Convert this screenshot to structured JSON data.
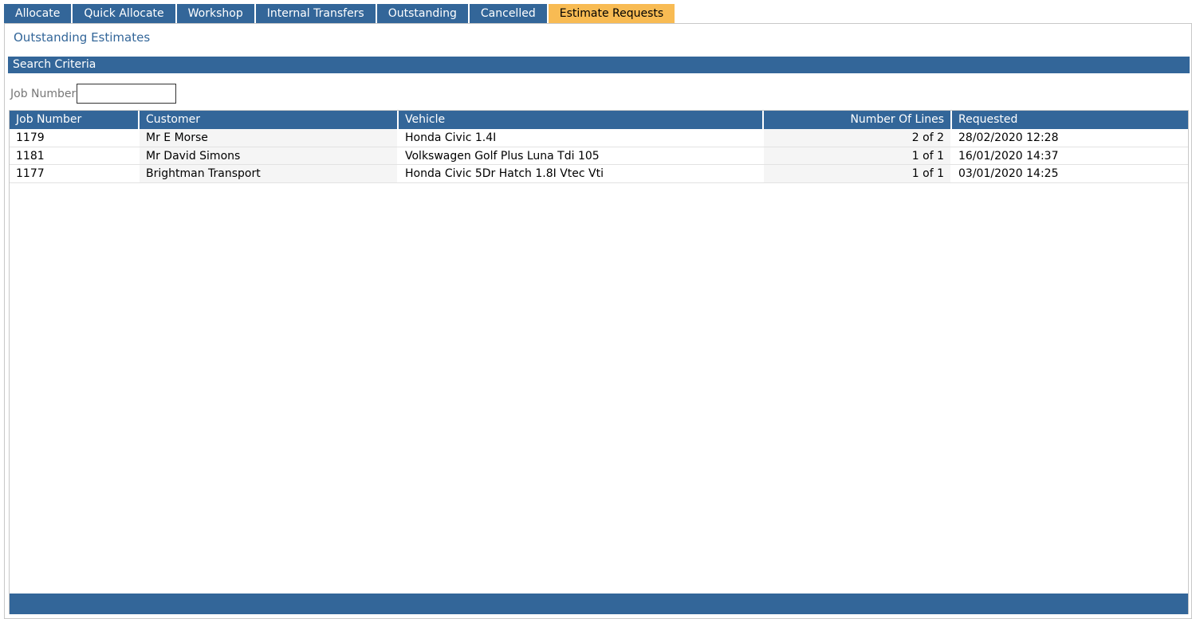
{
  "tabs": [
    {
      "label": "Allocate",
      "active": false
    },
    {
      "label": "Quick Allocate",
      "active": false
    },
    {
      "label": "Workshop",
      "active": false
    },
    {
      "label": "Internal Transfers",
      "active": false
    },
    {
      "label": "Outstanding",
      "active": false
    },
    {
      "label": "Cancelled",
      "active": false
    },
    {
      "label": "Estimate Requests",
      "active": true
    }
  ],
  "page_title": "Outstanding Estimates",
  "search": {
    "header": "Search Criteria",
    "job_number_label": "Job Number",
    "job_number_value": ""
  },
  "table": {
    "columns": [
      "Job Number",
      "Customer",
      "Vehicle",
      "Number Of Lines",
      "Requested"
    ],
    "rows": [
      [
        "1179",
        "Mr E Morse",
        "Honda Civic 1.4I",
        "2 of 2",
        "28/02/2020 12:28"
      ],
      [
        "1181",
        "Mr David Simons",
        "Volkswagen Golf Plus Luna Tdi 105",
        "1 of 1",
        "16/01/2020 14:37"
      ],
      [
        "1177",
        "Brightman Transport",
        "Honda Civic 5Dr Hatch 1.8I Vtec Vti",
        "1 of 1",
        "03/01/2020 14:25"
      ]
    ]
  },
  "colors": {
    "primary": "#336699",
    "active_tab": "#f8bb53"
  }
}
